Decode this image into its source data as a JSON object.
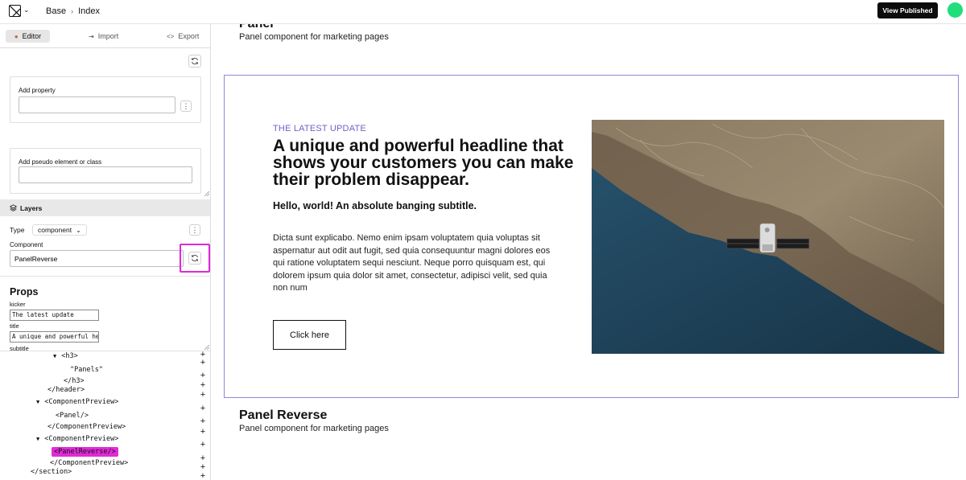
{
  "topbar": {
    "breadcrumbs": [
      "Base",
      "Index"
    ],
    "publish_label": "View Published",
    "avatar_color": "#21dd7a"
  },
  "sidebar": {
    "tabs": [
      {
        "label": "Editor",
        "icon": "palette-icon",
        "active": true
      },
      {
        "label": "Import",
        "icon": "import-icon",
        "active": false
      },
      {
        "label": "Export",
        "icon": "code-icon",
        "active": false
      }
    ],
    "add_property_label": "Add property",
    "add_property_value": "",
    "add_pseudo_label": "Add pseudo element or class",
    "add_pseudo_value": "",
    "layers": {
      "title": "Layers",
      "type_label": "Type",
      "type_value": "component",
      "component_label": "Component",
      "component_value": "PanelReverse"
    },
    "props": {
      "title": "Props",
      "fields": [
        {
          "label": "kicker",
          "value": "The latest update"
        },
        {
          "label": "title",
          "value": "A unique and powerful hea"
        },
        {
          "label": "subtitle",
          "value": ""
        }
      ]
    },
    "tree": [
      {
        "text": "<h3>",
        "toggle": "▼",
        "selected": false
      },
      {
        "text": "\"Panels\"",
        "toggle": "",
        "selected": false
      },
      {
        "text": "</h3>",
        "toggle": "",
        "selected": false
      },
      {
        "text": "</header>",
        "toggle": "",
        "selected": false
      },
      {
        "text": "<ComponentPreview>",
        "toggle": "▼",
        "selected": false
      },
      {
        "text": "<Panel/>",
        "toggle": "",
        "selected": false
      },
      {
        "text": "</ComponentPreview>",
        "toggle": "",
        "selected": false
      },
      {
        "text": "<ComponentPreview>",
        "toggle": "▼",
        "selected": false
      },
      {
        "text": "<PanelReverse/>",
        "toggle": "",
        "selected": true
      },
      {
        "text": "</ComponentPreview>",
        "toggle": "",
        "selected": false
      },
      {
        "text": "</section>",
        "toggle": "",
        "selected": false
      }
    ],
    "highlight_color": "#e028d9"
  },
  "canvas": {
    "top_section": {
      "title": "Panel",
      "description": "Panel component for marketing pages"
    },
    "preview": {
      "kicker": "THE LATEST UPDATE",
      "headline": "A unique and powerful headline that shows your customers you can make their problem disappear.",
      "subtitle": "Hello, world! An absolute banging subtitle.",
      "body": "Dicta sunt explicabo. Nemo enim ipsam voluptatem quia voluptas sit aspernatur aut odit aut fugit, sed quia consequuntur magni dolores eos qui ratione voluptatem sequi nesciunt. Neque porro quisquam est, qui dolorem ipsum quia dolor sit amet, consectetur, adipisci velit, sed quia non num",
      "cta_label": "Click here",
      "frame_color": "#8c88d8",
      "kicker_color": "#6b63c9"
    },
    "bottom_section": {
      "title": "Panel Reverse",
      "description": "Panel component for marketing pages"
    }
  }
}
